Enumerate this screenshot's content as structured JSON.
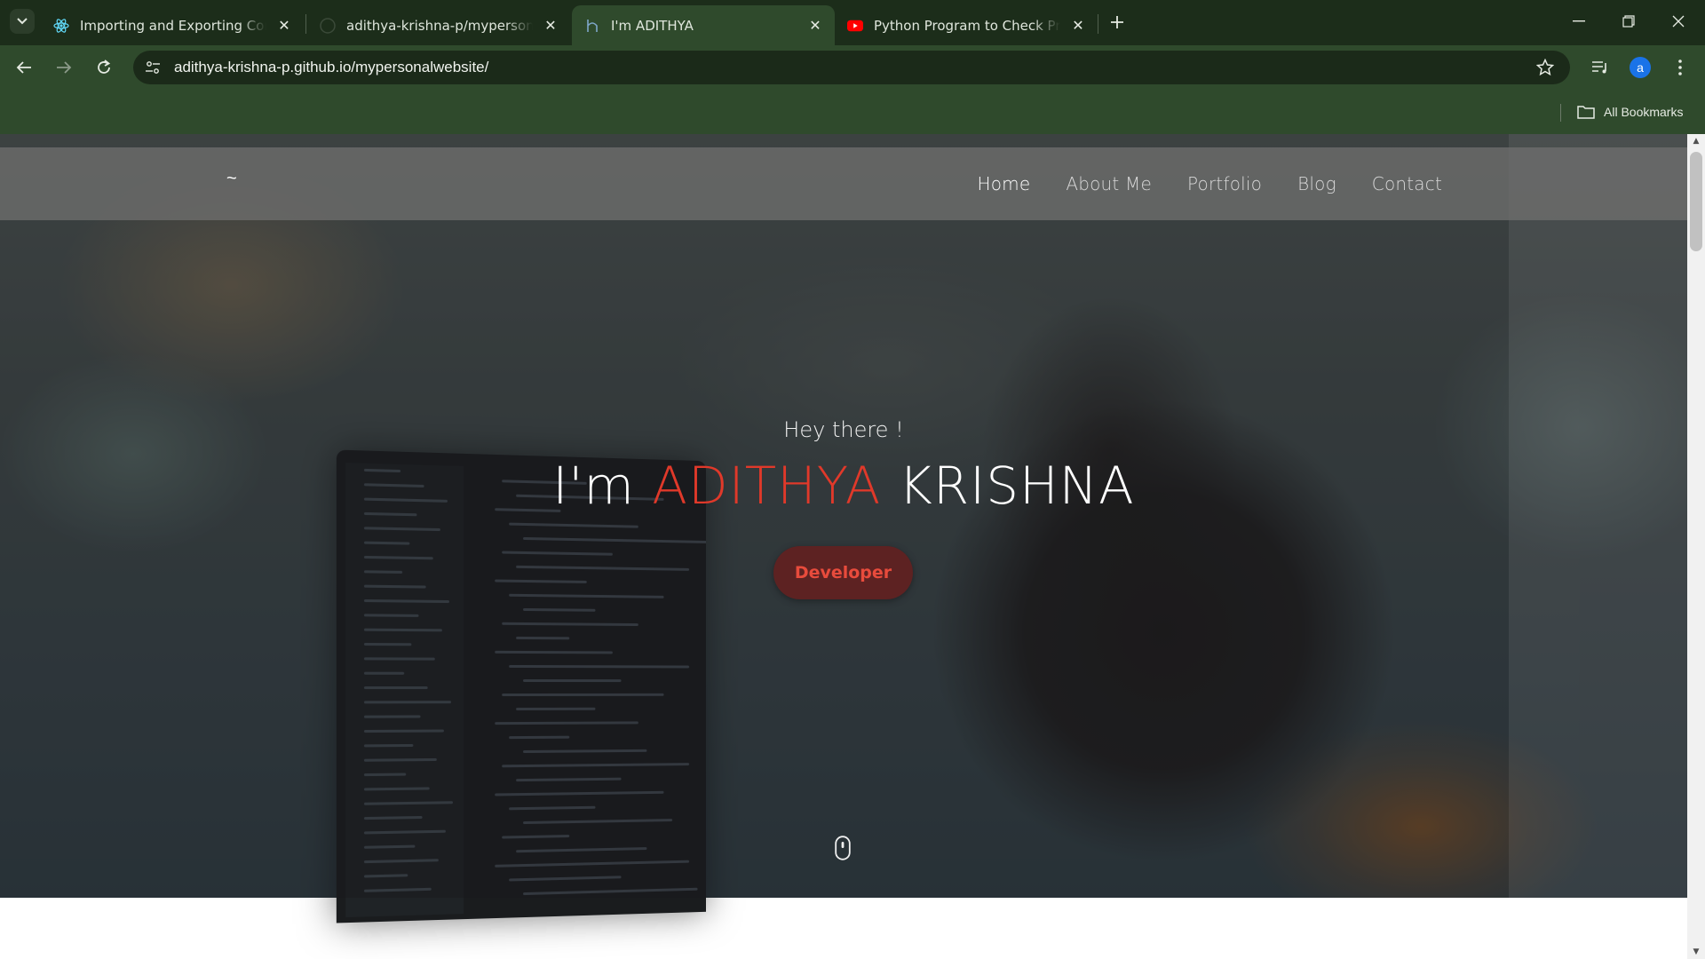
{
  "browser": {
    "tabs": [
      {
        "title": "Importing and Exporting Comp",
        "favicon": "react-icon",
        "active": false
      },
      {
        "title": "adithya-krishna-p/mypersonalw",
        "favicon": "github-icon",
        "active": false
      },
      {
        "title": "I'm ADITHYA",
        "favicon": "site-icon",
        "active": true
      },
      {
        "title": "Python Program to Check Prim",
        "favicon": "youtube-icon",
        "active": false
      }
    ],
    "address_bar": {
      "url": "adithya-krishna-p.github.io/mypersonalwebsite/"
    },
    "profile_initial": "a",
    "bookmarks": {
      "all_label": "All Bookmarks"
    }
  },
  "site": {
    "brand": "~",
    "nav": [
      "Home",
      "About Me",
      "Portfolio",
      "Blog",
      "Contact"
    ],
    "active_nav": "Home",
    "hero": {
      "greeting": "Hey there !",
      "headline_prefix": "I'm ",
      "headline_accent": "ADITHYA",
      "headline_suffix": " KRISHNA",
      "role_button": "Developer"
    }
  },
  "colors": {
    "accent": "#e0392a",
    "chrome": "#2f4a2c",
    "tabstrip": "#1c2d1a"
  }
}
